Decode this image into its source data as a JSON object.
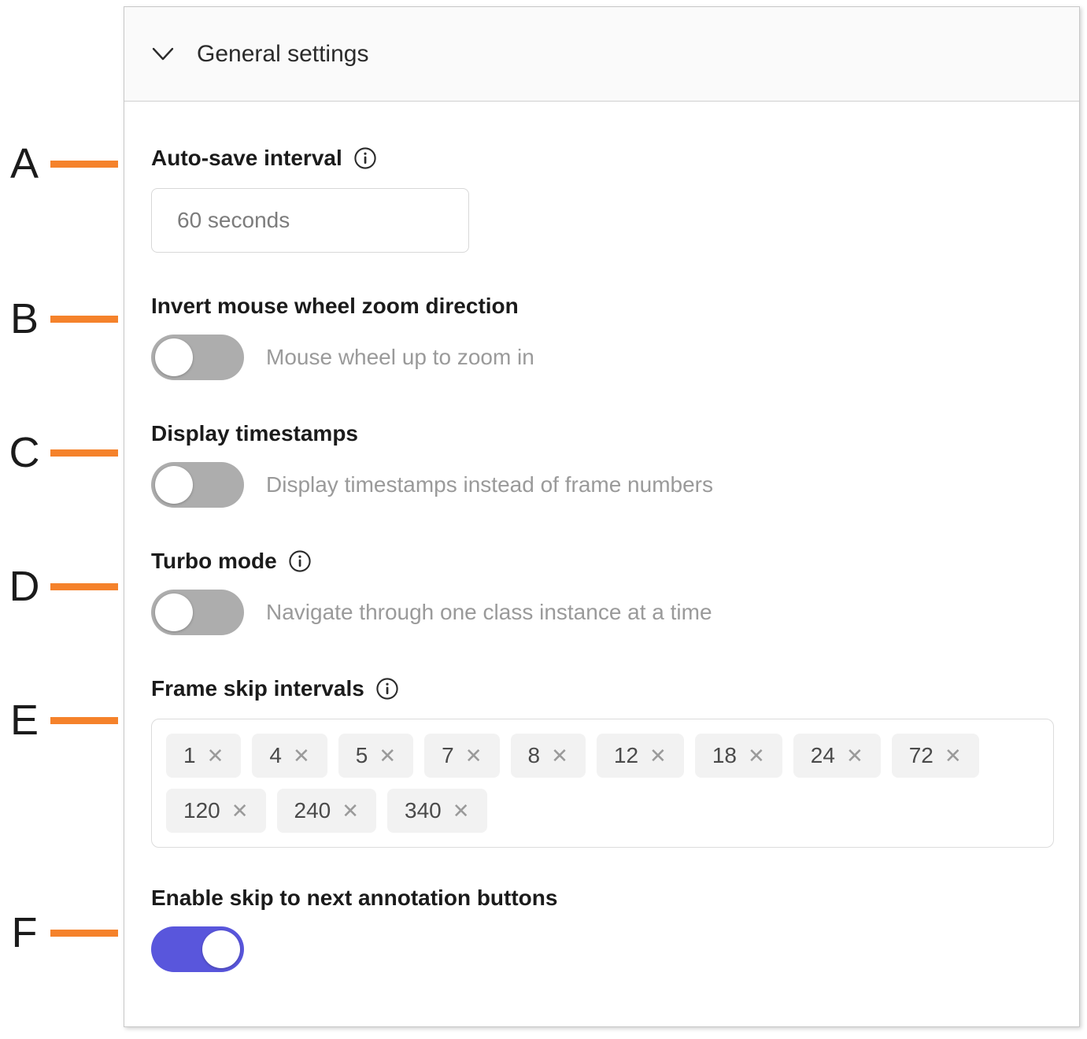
{
  "panel": {
    "section": {
      "title": "General settings",
      "chevron_icon": "chevron-down-icon",
      "expanded": true
    },
    "fields": [
      {
        "key": "auto_save",
        "annotation": "A",
        "label": "Auto-save interval",
        "info_icon": "info-icon",
        "has_info": true,
        "control": "text-input",
        "value": "",
        "placeholder": "60 seconds"
      },
      {
        "key": "invert_zoom",
        "annotation": "B",
        "label": "Invert mouse wheel zoom direction",
        "has_info": false,
        "control": "toggle",
        "toggle_on": false,
        "description": "Mouse wheel up to zoom in"
      },
      {
        "key": "display_timestamps",
        "annotation": "C",
        "label": "Display timestamps",
        "has_info": false,
        "control": "toggle",
        "toggle_on": false,
        "description": "Display timestamps instead of frame numbers"
      },
      {
        "key": "turbo_mode",
        "annotation": "D",
        "label": "Turbo mode",
        "info_icon": "info-icon",
        "has_info": true,
        "control": "toggle",
        "toggle_on": false,
        "description": "Navigate through one class instance at a time"
      },
      {
        "key": "frame_skip",
        "annotation": "E",
        "label": "Frame skip intervals",
        "info_icon": "info-icon",
        "has_info": true,
        "control": "chips",
        "chips": [
          {
            "value": "1",
            "remove_icon": "close-icon"
          },
          {
            "value": "4",
            "remove_icon": "close-icon"
          },
          {
            "value": "5",
            "remove_icon": "close-icon"
          },
          {
            "value": "7",
            "remove_icon": "close-icon"
          },
          {
            "value": "8",
            "remove_icon": "close-icon"
          },
          {
            "value": "12",
            "remove_icon": "close-icon"
          },
          {
            "value": "18",
            "remove_icon": "close-icon"
          },
          {
            "value": "24",
            "remove_icon": "close-icon"
          },
          {
            "value": "72",
            "remove_icon": "close-icon"
          },
          {
            "value": "120",
            "remove_icon": "close-icon"
          },
          {
            "value": "240",
            "remove_icon": "close-icon"
          },
          {
            "value": "340",
            "remove_icon": "close-icon"
          }
        ]
      },
      {
        "key": "skip_to_next_annotation",
        "annotation": "F",
        "label": "Enable skip to next annotation buttons",
        "has_info": false,
        "control": "toggle",
        "toggle_on": true,
        "description": ""
      }
    ]
  },
  "annotations": {
    "letters": [
      "A",
      "B",
      "C",
      "D",
      "E",
      "F"
    ],
    "line_color": "#F5822B"
  },
  "colors": {
    "accent_orange": "#F5822B",
    "toggle_on": "#5956DC",
    "toggle_off": "#ADADAD",
    "header_bg": "#FAFAFA",
    "chip_bg": "#F2F2F2",
    "border": "#C8C8C8",
    "muted_text": "#9A9A9A"
  },
  "chip_x_glyph": "✕"
}
